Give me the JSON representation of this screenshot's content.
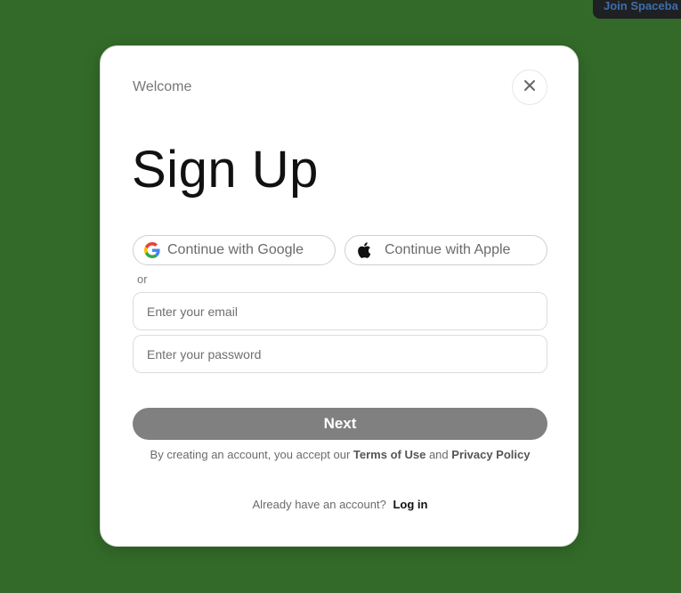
{
  "corner_popup": {
    "text": "Join Spaceba"
  },
  "modal": {
    "welcome": "Welcome",
    "title": "Sign Up",
    "close_icon": "close-icon",
    "social": {
      "google_label": "Continue with Google",
      "google_icon": "google-icon",
      "apple_label": "Continue with Apple",
      "apple_icon": "apple-icon"
    },
    "divider_text": "or",
    "email": {
      "value": "",
      "placeholder": "Enter your email"
    },
    "password": {
      "value": "",
      "placeholder": "Enter your password"
    },
    "next_label": "Next",
    "terms": {
      "prefix": "By creating an account, you accept our",
      "terms_link": "Terms of Use",
      "conjunction": "and",
      "privacy_link": "Privacy Policy"
    },
    "login": {
      "prompt": "Already have an account?",
      "link": "Log in"
    }
  },
  "colors": {
    "background": "#336a29",
    "next_button": "#808080",
    "modal": "#ffffff"
  }
}
